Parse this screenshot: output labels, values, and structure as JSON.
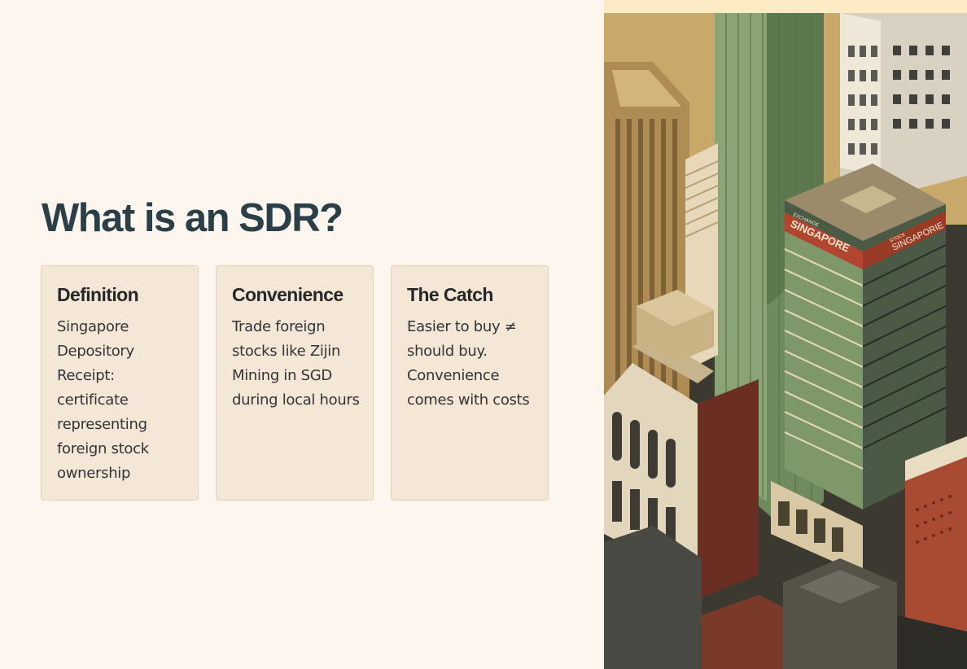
{
  "slide": {
    "title": "What is an SDR?",
    "cards": [
      {
        "heading": "Definition",
        "body": "Singapore Depository Receipt: certificate representing foreign stock ownership"
      },
      {
        "heading": "Convenience",
        "body": "Trade foreign stocks like Zijin Mining in SGD during local hours"
      },
      {
        "heading": "The Catch",
        "body": "Easier to buy ≠ should buy. Convenience comes with costs"
      }
    ]
  },
  "illustration": {
    "sign_main": "SINGAPORE",
    "sign_main_small": "EXCHANGE",
    "sign_side": "SINGAPORIE",
    "sign_side_small": "STOCK"
  },
  "colors": {
    "background": "#fdf6ef",
    "card": "#f4e7d5",
    "title": "#2a3f47",
    "accent_red": "#b2452f"
  }
}
